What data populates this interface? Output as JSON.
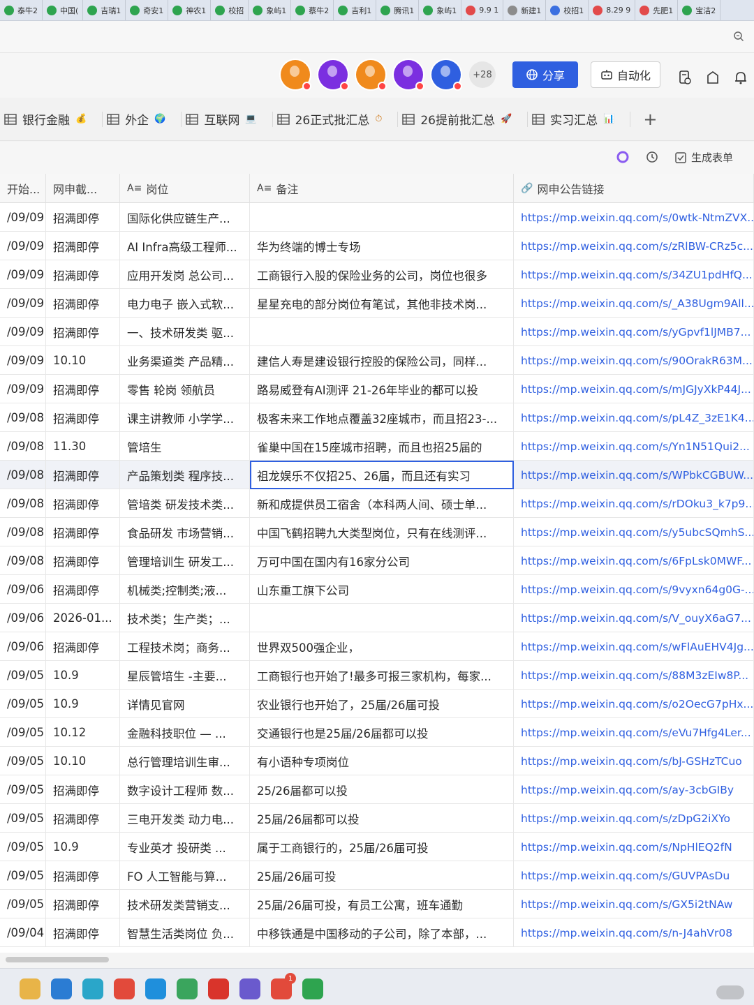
{
  "browser_tabs": [
    {
      "label": "泰牛2",
      "color": "#2ea44f"
    },
    {
      "label": "中国(",
      "color": "#2ea44f"
    },
    {
      "label": "吉瑞1",
      "color": "#2ea44f"
    },
    {
      "label": "奇安1",
      "color": "#2ea44f"
    },
    {
      "label": "神农1",
      "color": "#2ea44f"
    },
    {
      "label": "校招",
      "color": "#2ea44f"
    },
    {
      "label": "象屿1",
      "color": "#2ea44f"
    },
    {
      "label": "蔡牛2",
      "color": "#2ea44f"
    },
    {
      "label": "吉利1",
      "color": "#2ea44f"
    },
    {
      "label": "腾讯1",
      "color": "#2ea44f"
    },
    {
      "label": "象屿1",
      "color": "#2ea44f"
    },
    {
      "label": "9.9 1",
      "color": "#e24a4a"
    },
    {
      "label": "新建1",
      "color": "#8c8c8c"
    },
    {
      "label": "校招1",
      "color": "#3b6fe0"
    },
    {
      "label": "8.29 9",
      "color": "#e24a4a"
    },
    {
      "label": "先肥1",
      "color": "#e24a4a"
    },
    {
      "label": "宝洁2",
      "color": "#2ea44f"
    }
  ],
  "header": {
    "avatars": [
      {
        "color": "#f08a1c"
      },
      {
        "color": "#7b2fe0"
      },
      {
        "color": "#f08a1c"
      },
      {
        "color": "#7b2fe0"
      },
      {
        "color": "#2f5fe0"
      }
    ],
    "more_count": "+28",
    "share_label": "分享",
    "automation_label": "自动化"
  },
  "sheet_tabs": [
    {
      "label": "银行金融",
      "emoji": "💰"
    },
    {
      "label": "外企",
      "emoji": "🌍"
    },
    {
      "label": "互联网",
      "emoji": "💻"
    },
    {
      "label": "26正式批汇总",
      "emoji": "⏱"
    },
    {
      "label": "26提前批汇总",
      "emoji": "🚀"
    },
    {
      "label": "实习汇总",
      "emoji": "📊"
    }
  ],
  "toolbar": {
    "generate_form_label": "生成表单"
  },
  "columns": [
    {
      "label": "开始..."
    },
    {
      "label": "网申截..."
    },
    {
      "label": "岗位",
      "type_icon": "A≡"
    },
    {
      "label": "备注",
      "type_icon": "A≡"
    },
    {
      "label": "网申公告链接",
      "type_icon": "🔗"
    }
  ],
  "rows": [
    {
      "start": "/09/09",
      "deadline": "招满即停",
      "position": "国际化供应链生产...",
      "note": "",
      "link": "https://mp.weixin.qq.com/s/0wtk-NtmZVX..."
    },
    {
      "start": "/09/09",
      "deadline": "招满即停",
      "position": "AI Infra高级工程师...",
      "note": "华为终端的博士专场",
      "link": "https://mp.weixin.qq.com/s/zRlBW-CRz5c..."
    },
    {
      "start": "/09/09",
      "deadline": "招满即停",
      "position": "应用开发岗 总公司...",
      "note": "工商银行入股的保险业务的公司，岗位也很多",
      "link": "https://mp.weixin.qq.com/s/34ZU1pdHfQ..."
    },
    {
      "start": "/09/09",
      "deadline": "招满即停",
      "position": "电力电子 嵌入式软...",
      "note": "星星充电的部分岗位有笔试，其他非技术岗...",
      "link": "https://mp.weixin.qq.com/s/_A38Ugm9All..."
    },
    {
      "start": "/09/09",
      "deadline": "招满即停",
      "position": "一、技术研发类 驱...",
      "note": "",
      "link": "https://mp.weixin.qq.com/s/yGpvf1lJMB7..."
    },
    {
      "start": "/09/09",
      "deadline": "10.10",
      "position": "业务渠道类 产品精...",
      "note": "建信人寿是建设银行控股的保险公司，同样...",
      "link": "https://mp.weixin.qq.com/s/90OrakR63M..."
    },
    {
      "start": "/09/09",
      "deadline": "招满即停",
      "position": "零售 轮岗 领航员",
      "note": "路易威登有AI测评 21-26年毕业的都可以投",
      "link": "https://mp.weixin.qq.com/s/mJGJyXkP44J..."
    },
    {
      "start": "/09/08",
      "deadline": "招满即停",
      "position": "课主讲教师 小学学...",
      "note": "极客未来工作地点覆盖32座城市，而且招23-...",
      "link": "https://mp.weixin.qq.com/s/pL4Z_3zE1K4..."
    },
    {
      "start": "/09/08",
      "deadline": "11.30",
      "position": "管培生",
      "note": "雀巢中国在15座城市招聘，而且也招25届的",
      "link": "https://mp.weixin.qq.com/s/Yn1N51Qui2..."
    },
    {
      "start": "/09/08",
      "deadline": "招满即停",
      "position": "产品策划类 程序技...",
      "note": "祖龙娱乐不仅招25、26届，而且还有实习",
      "link": "https://mp.weixin.qq.com/s/WPbkCGBUW...",
      "selected": true
    },
    {
      "start": "/09/08",
      "deadline": "招满即停",
      "position": "管培类 研发技术类...",
      "note": "新和成提供员工宿舍（本科两人间、硕士单...",
      "link": "https://mp.weixin.qq.com/s/rDOku3_k7p9..."
    },
    {
      "start": "/09/08",
      "deadline": "招满即停",
      "position": "食品研发 市场营销...",
      "note": "中国飞鹤招聘九大类型岗位，只有在线测评...",
      "link": "https://mp.weixin.qq.com/s/y5ubcSQmhS..."
    },
    {
      "start": "/09/08",
      "deadline": "招满即停",
      "position": "管理培训生 研发工...",
      "note": "万可中国在国内有16家分公司",
      "link": "https://mp.weixin.qq.com/s/6FpLsk0MWF..."
    },
    {
      "start": "/09/06",
      "deadline": "招满即停",
      "position": "机械类;控制类;液...",
      "note": "山东重工旗下公司",
      "link": "https://mp.weixin.qq.com/s/9vyxn64g0G-..."
    },
    {
      "start": "/09/06",
      "deadline": "2026-01...",
      "position": "技术类；生产类；...",
      "note": "",
      "link": "https://mp.weixin.qq.com/s/V_ouyX6aG7..."
    },
    {
      "start": "/09/06",
      "deadline": "招满即停",
      "position": "工程技术岗；商务...",
      "note": "世界双500强企业，",
      "link": "https://mp.weixin.qq.com/s/wFlAuEHV4Jg..."
    },
    {
      "start": "/09/05",
      "deadline": "10.9",
      "position": "星辰管培生 -主要...",
      "note": "工商银行也开始了!最多可报三家机构，每家...",
      "link": "https://mp.weixin.qq.com/s/88M3zEIw8P..."
    },
    {
      "start": "/09/05",
      "deadline": "10.9",
      "position": "详情见官网",
      "note": "农业银行也开始了，25届/26届可投",
      "link": "https://mp.weixin.qq.com/s/o2OecG7pHx..."
    },
    {
      "start": "/09/05",
      "deadline": "10.12",
      "position": "金融科技职位 — ...",
      "note": "交通银行也是25届/26届都可以投",
      "link": "https://mp.weixin.qq.com/s/eVu7Hfg4Ler..."
    },
    {
      "start": "/09/05",
      "deadline": "10.10",
      "position": "总行管理培训生审...",
      "note": "有小语种专项岗位",
      "link": "https://mp.weixin.qq.com/s/bJ-GSHzTCuo"
    },
    {
      "start": "/09/05",
      "deadline": "招满即停",
      "position": "数字设计工程师 数...",
      "note": "25/26届都可以投",
      "link": "https://mp.weixin.qq.com/s/ay-3cbGIBy"
    },
    {
      "start": "/09/05",
      "deadline": "招满即停",
      "position": "三电开发类 动力电...",
      "note": "25届/26届都可以投",
      "link": "https://mp.weixin.qq.com/s/zDpG2iXYo"
    },
    {
      "start": "/09/05",
      "deadline": "10.9",
      "position": "专业英才 投研类 ...",
      "note": "属于工商银行的，25届/26届可投",
      "link": "https://mp.weixin.qq.com/s/NpHlEQ2fN"
    },
    {
      "start": "/09/05",
      "deadline": "招满即停",
      "position": "FO 人工智能与算...",
      "note": "25届/26届可投",
      "link": "https://mp.weixin.qq.com/s/GUVPAsDu"
    },
    {
      "start": "/09/05",
      "deadline": "招满即停",
      "position": "技术研发类营销支...",
      "note": "25届/26届可投，有员工公寓，班车通勤",
      "link": "https://mp.weixin.qq.com/s/GX5i2tNAw"
    },
    {
      "start": "/09/04",
      "deadline": "招满即停",
      "position": "智慧生活类岗位 负...",
      "note": "中移铁通是中国移动的子公司，除了本部，...",
      "link": "https://mp.weixin.qq.com/s/n-J4ahVr08"
    }
  ],
  "taskbar": {
    "apps": [
      {
        "name": "folder",
        "color": "#e8b448"
      },
      {
        "name": "browser-blue",
        "color": "#2b7cd3"
      },
      {
        "name": "arrow-app",
        "color": "#2aa6c9"
      },
      {
        "name": "chrome",
        "color": "#e24a3b"
      },
      {
        "name": "edge",
        "color": "#1f8fdc"
      },
      {
        "name": "globe",
        "color": "#3aa55d"
      },
      {
        "name": "wps",
        "color": "#d9342b"
      },
      {
        "name": "draw-app",
        "color": "#6a5acd"
      },
      {
        "name": "notification-app",
        "color": "#e24a3b"
      },
      {
        "name": "wechat",
        "color": "#2ea44f"
      }
    ],
    "badge": "1"
  },
  "colors": {
    "accent": "#2f5fe0",
    "link": "#2f5fe0"
  }
}
